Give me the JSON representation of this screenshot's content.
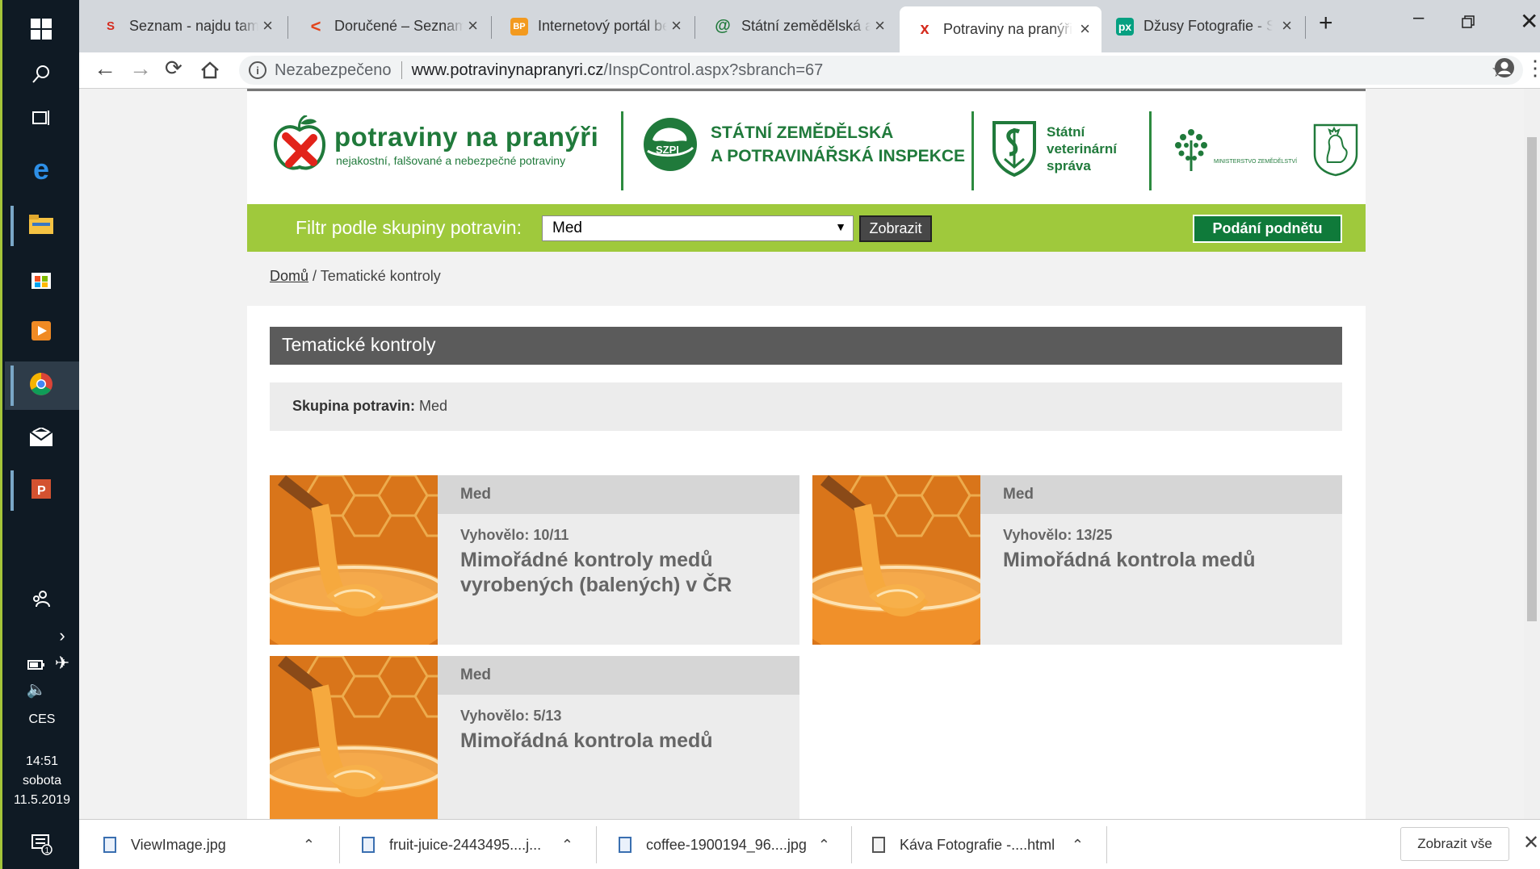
{
  "browser": {
    "tabs": [
      {
        "title": "Seznam - najdu tam, co neznám",
        "favicon": "S"
      },
      {
        "title": "Doručené – Seznam Email",
        "favicon": "<"
      },
      {
        "title": "Internetový portál bezpečnosti potravin",
        "favicon": "BP"
      },
      {
        "title": "Státní zemědělská a potravinářská",
        "favicon": "@"
      },
      {
        "title": "Potraviny na pranýři | Tematické",
        "favicon": "x"
      },
      {
        "title": "Džusy Fotografie - Stáhněte",
        "favicon": "px"
      }
    ],
    "new_tab": "+",
    "security_label": "Nezabezpečeno",
    "url_host": "www.potravinynapranyri.cz",
    "url_path": "/InspControl.aspx?sbranch=67"
  },
  "taskbar": {
    "language": "CES",
    "time": "14:51",
    "day": "sobota",
    "date": "11.5.2019",
    "notification_count": "1"
  },
  "header": {
    "brand_title": "potraviny na pranýři",
    "brand_subtitle": "nejakostní, falšované a nebezpečné potraviny",
    "szpi_badge": "SZPI",
    "szpi_line1": "STÁTNÍ ZEMĚDĚLSKÁ",
    "szpi_line2": "A POTRAVINÁŘSKÁ INSPEKCE",
    "svs_line1": "Státní",
    "svs_line2": "veterinární",
    "svs_line3": "správa",
    "mze_label": "MINISTERSTVO ZEMĚDĚLSTVÍ"
  },
  "filter": {
    "label": "Filtr podle skupiny potravin:",
    "selected": "Med",
    "show_button": "Zobrazit",
    "submit_button": "Podání podnětu"
  },
  "breadcrumb": {
    "home": "Domů",
    "separator": " / ",
    "current": "Tematické kontroly"
  },
  "panel": {
    "title": "Tematické kontroly",
    "group_label": "Skupina potravin:",
    "group_value": "Med"
  },
  "cards": [
    {
      "category": "Med",
      "score": "Vyhovělo: 10/11",
      "title": "Mimořádné kontroly medů vyrobených (balených) v ČR"
    },
    {
      "category": "Med",
      "score": "Vyhovělo: 13/25",
      "title": "Mimořádná kontrola medů"
    },
    {
      "category": "Med",
      "score": "Vyhovělo: 5/13",
      "title": "Mimořádná kontrola medů"
    }
  ],
  "downloads": {
    "items": [
      {
        "name": "ViewImage.jpg"
      },
      {
        "name": "fruit-juice-2443495....j..."
      },
      {
        "name": "coffee-1900194_96....jpg"
      },
      {
        "name": "Káva Fotografie -....html"
      }
    ],
    "show_all": "Zobrazit vše"
  },
  "colors": {
    "brand_green": "#207a3b",
    "filter_bar": "#9fc93c",
    "panel_header": "#5b5b5b"
  }
}
